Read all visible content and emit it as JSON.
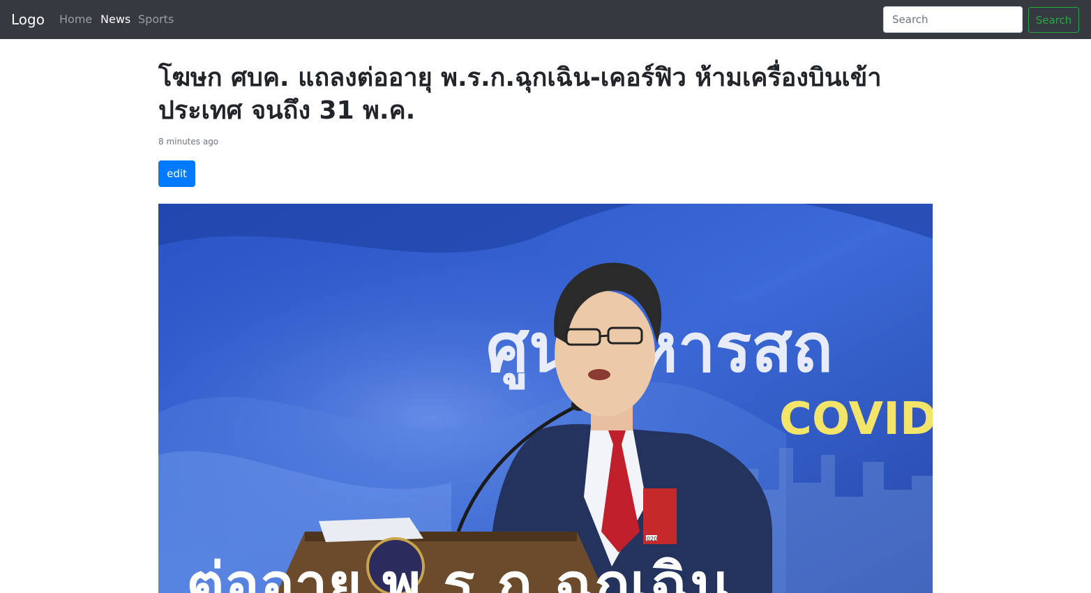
{
  "navbar": {
    "brand": "Logo",
    "links": [
      {
        "label": "Home",
        "active": false
      },
      {
        "label": "News",
        "active": true
      },
      {
        "label": "Sports",
        "active": false
      }
    ],
    "search": {
      "placeholder": "Search",
      "button_label": "Search"
    }
  },
  "article": {
    "title": "โฆษก ศบค. แถลงต่ออายุ พ.ร.ก.ฉุกเฉิน-เคอร์ฟิว ห้ามเครื่องบินเข้าประเทศ จนถึง 31 พ.ค.",
    "meta": "8 minutes ago",
    "edit_label": "edit",
    "image": {
      "backdrop_text": "ศูน  ริหารสถ",
      "backdrop_subtext": "COVID",
      "caption_text": "ต่ออายุ พ.ร.ก.ฉุกเฉิน",
      "badge_number": "020"
    }
  },
  "colors": {
    "navbar_bg": "#343a40",
    "primary": "#007bff",
    "success": "#28a745",
    "hero_blue": "#2c54c6"
  }
}
